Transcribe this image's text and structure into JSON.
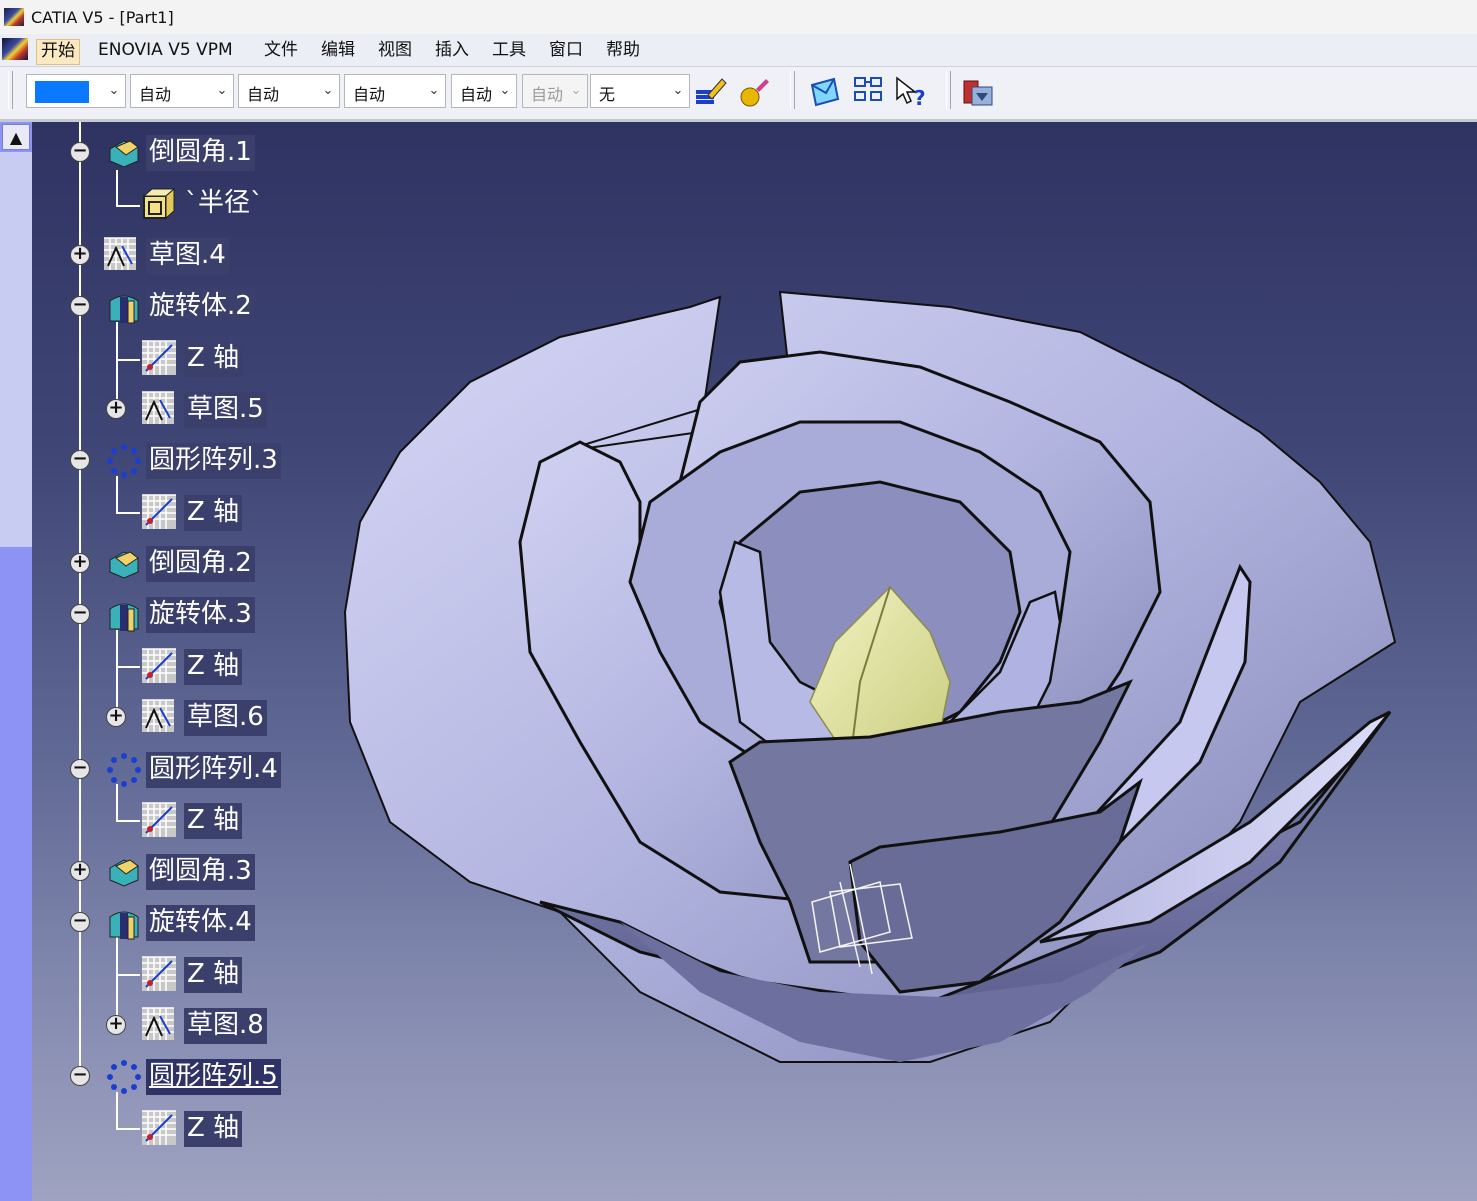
{
  "window": {
    "title": "CATIA V5 - [Part1]"
  },
  "menu": {
    "items": [
      {
        "label": "开始",
        "active": true
      },
      {
        "label": "ENOVIA V5 VPM"
      },
      {
        "label": "文件"
      },
      {
        "label": "编辑"
      },
      {
        "label": "视图"
      },
      {
        "label": "插入"
      },
      {
        "label": "工具"
      },
      {
        "label": "窗口"
      },
      {
        "label": "帮助"
      }
    ]
  },
  "toolbar": {
    "color_value": "#0a78ff",
    "combos": [
      {
        "value": "自动"
      },
      {
        "value": "自动"
      },
      {
        "value": "自动"
      },
      {
        "value": "自动"
      },
      {
        "value": "自动",
        "disabled": true
      },
      {
        "value": "无"
      }
    ],
    "icons": [
      "painter-brush-icon",
      "apply-material-icon",
      "envelope-icon",
      "grid-nodes-icon",
      "whats-this-icon",
      "catalog-browser-icon"
    ]
  },
  "tree": {
    "nodes": [
      {
        "label": "倒圆角.1",
        "icon": "fillet-icon",
        "expander": "-"
      },
      {
        "label": "`半径`",
        "icon": "parameter-icon",
        "expander": ""
      },
      {
        "label": "草图.4",
        "icon": "sketch-icon",
        "expander": "+"
      },
      {
        "label": "旋转体.2",
        "icon": "revolve-icon",
        "expander": "-"
      },
      {
        "label": "Z 轴",
        "icon": "axis-icon",
        "expander": ""
      },
      {
        "label": "草图.5",
        "icon": "sketch-icon",
        "expander": "+"
      },
      {
        "label": "圆形阵列.3",
        "icon": "circular-pattern-icon",
        "expander": "-"
      },
      {
        "label": "Z 轴",
        "icon": "axis-icon",
        "expander": ""
      },
      {
        "label": "倒圆角.2",
        "icon": "fillet-icon",
        "expander": "+"
      },
      {
        "label": "旋转体.3",
        "icon": "revolve-icon",
        "expander": "-"
      },
      {
        "label": "Z 轴",
        "icon": "axis-icon",
        "expander": ""
      },
      {
        "label": "草图.6",
        "icon": "sketch-icon",
        "expander": "+"
      },
      {
        "label": "圆形阵列.4",
        "icon": "circular-pattern-icon",
        "expander": "-"
      },
      {
        "label": "Z 轴",
        "icon": "axis-icon",
        "expander": ""
      },
      {
        "label": "倒圆角.3",
        "icon": "fillet-icon",
        "expander": "+"
      },
      {
        "label": "旋转体.4",
        "icon": "revolve-icon",
        "expander": "-"
      },
      {
        "label": "Z 轴",
        "icon": "axis-icon",
        "expander": ""
      },
      {
        "label": "草图.8",
        "icon": "sketch-icon",
        "expander": "+"
      },
      {
        "label": "圆形阵列.5",
        "icon": "circular-pattern-icon",
        "expander": "-",
        "selected": true
      },
      {
        "label": "Z 轴",
        "icon": "axis-icon",
        "expander": ""
      }
    ]
  },
  "viewport": {
    "model": "rose-flower-3d-model",
    "petal_color": "#c9cbee",
    "bud_color": "#e4e6a4"
  }
}
